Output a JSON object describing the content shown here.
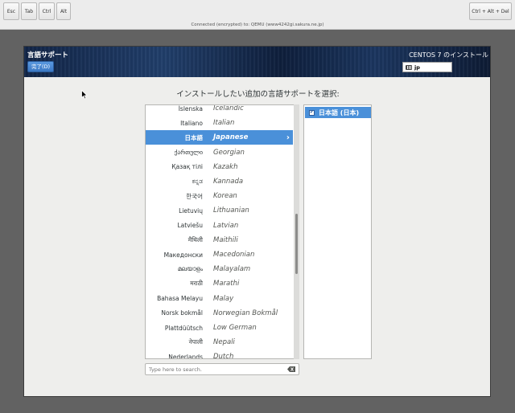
{
  "vnc_toolbar": {
    "esc": "Esc",
    "tab": "Tab",
    "ctrl": "Ctrl",
    "alt": "Alt",
    "ctrl_alt_del": "Ctrl + Alt + Del",
    "status": "Connected (encrypted) to: QEMU (www4242gi.sakura.ne.jp)"
  },
  "header": {
    "page_title": "言語サポート",
    "done_button": "完了(D)",
    "install_title": "CENTOS 7 のインストール",
    "keyboard_layout": "jp"
  },
  "prompt": "インストールしたい追加の言語サポートを選択:",
  "language_list": [
    {
      "native": "Íslenska",
      "english": "Icelandic"
    },
    {
      "native": "Italiano",
      "english": "Italian"
    },
    {
      "native": "日本語",
      "english": "Japanese",
      "selected": true
    },
    {
      "native": "ქართული",
      "english": "Georgian"
    },
    {
      "native": "Қазақ тілі",
      "english": "Kazakh"
    },
    {
      "native": "ಕನ್ನಡ",
      "english": "Kannada"
    },
    {
      "native": "한국어",
      "english": "Korean"
    },
    {
      "native": "Lietuvių",
      "english": "Lithuanian"
    },
    {
      "native": "Latviešu",
      "english": "Latvian"
    },
    {
      "native": "मैथिली",
      "english": "Maithili"
    },
    {
      "native": "Македонски",
      "english": "Macedonian"
    },
    {
      "native": "മലയാളം",
      "english": "Malayalam"
    },
    {
      "native": "मराठी",
      "english": "Marathi"
    },
    {
      "native": "Bahasa Melayu",
      "english": "Malay"
    },
    {
      "native": "Norsk bokmål",
      "english": "Norwegian Bokmål"
    },
    {
      "native": "Plattdüütsch",
      "english": "Low German"
    },
    {
      "native": "नेपाली",
      "english": "Nepali"
    },
    {
      "native": "Nederlands",
      "english": "Dutch"
    }
  ],
  "search": {
    "placeholder": "Type here to search.",
    "value": ""
  },
  "locales": [
    {
      "label": "日本語 (日本)",
      "checked": true
    }
  ],
  "colors": {
    "selection": "#4a90d9",
    "banner": "#1b3660"
  }
}
